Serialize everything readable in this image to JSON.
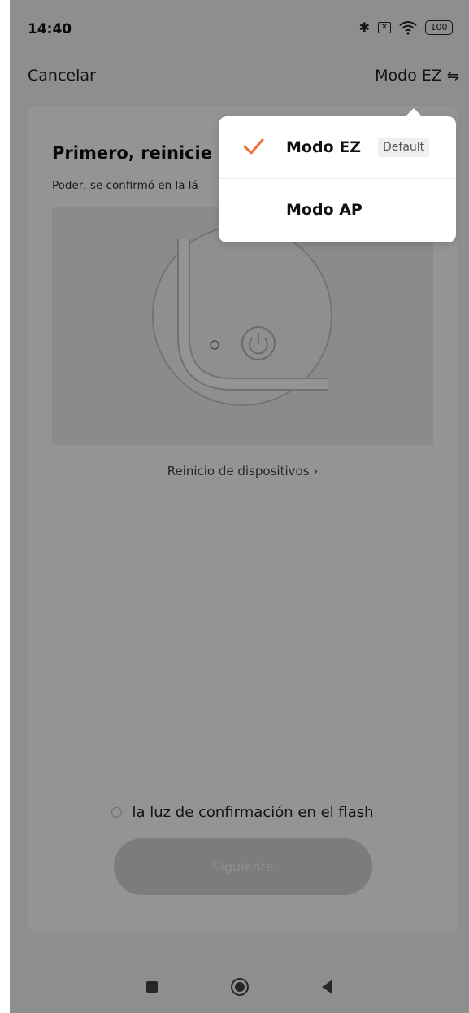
{
  "status_bar": {
    "time": "14:40",
    "battery": "100"
  },
  "header": {
    "cancel_label": "Cancelar",
    "mode_label": "Modo EZ"
  },
  "card": {
    "title": "Primero, reinicie e",
    "subtitle": "Poder, se confirmó en la lá",
    "reset_link": "Reinicio de dispositivos",
    "confirm_text": "la luz de confirmación en el flash",
    "next_label": "Siguiente"
  },
  "dropdown": {
    "items": [
      {
        "label": "Modo EZ",
        "badge": "Default",
        "selected": true
      },
      {
        "label": "Modo AP",
        "selected": false
      }
    ],
    "accent_color": "#f26b3a"
  }
}
